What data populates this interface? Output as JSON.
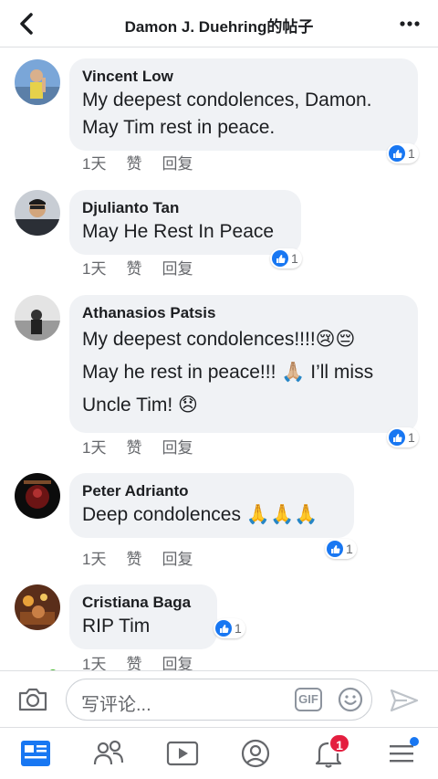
{
  "header": {
    "title": "Damon J. Duehring的帖子"
  },
  "comments": [
    {
      "name": "Vincent Low",
      "lines": [
        "My deepest condolences, Damon.",
        "May Tim rest in peace."
      ],
      "time": "1天",
      "like": "赞",
      "reply": "回复",
      "reactions": "1"
    },
    {
      "name": "Djulianto Tan",
      "lines": [
        "May He Rest In Peace"
      ],
      "time": "1天",
      "like": "赞",
      "reply": "回复",
      "reactions": "1"
    },
    {
      "name": "Athanasios Patsis",
      "lines": [
        "My deepest condolences!!!!😢😔",
        "May he rest in peace!!! 🙏🏼 I’ll miss",
        "Uncle Tim! 😞"
      ],
      "time": "1天",
      "like": "赞",
      "reply": "回复",
      "reactions": "1"
    },
    {
      "name": "Peter Adrianto",
      "lines": [
        "Deep condolences 🙏🙏🙏"
      ],
      "time": "1天",
      "like": "赞",
      "reply": "回复",
      "reactions": "1"
    },
    {
      "name": "Cristiana Baga",
      "lines": [
        "RIP Tim"
      ],
      "time": "1天",
      "like": "赞",
      "reply": "回复",
      "reactions": "1"
    }
  ],
  "compose": {
    "placeholder": "写评论...",
    "gif_label": "GIF"
  },
  "tabbar": {
    "notifications_badge": "1"
  },
  "colors": {
    "accent": "#1877f2",
    "bubble": "#f0f2f5",
    "badge": "#e41e3f",
    "online": "#42b72a"
  }
}
